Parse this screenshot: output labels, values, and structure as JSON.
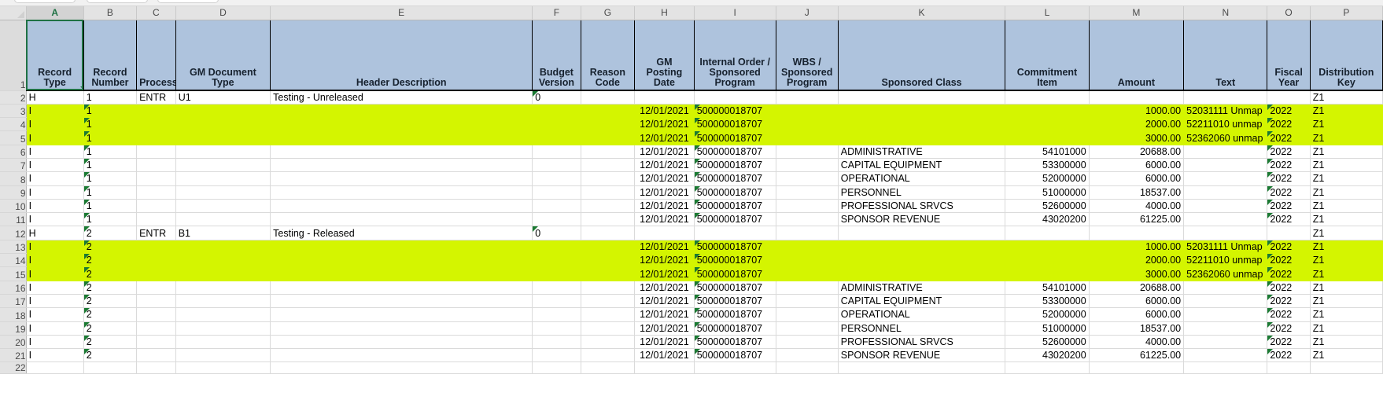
{
  "app": {
    "type": "spreadsheet",
    "selected_cell": "A1",
    "highlight_color": "#d4f500",
    "header_fill_color": "#aec3dd",
    "selection_color": "#1f7244"
  },
  "columns": {
    "letters": [
      "A",
      "B",
      "C",
      "D",
      "E",
      "F",
      "G",
      "H",
      "I",
      "J",
      "K",
      "L",
      "M",
      "N",
      "O",
      "P"
    ],
    "widths": [
      62,
      57,
      42,
      102,
      282,
      52,
      58,
      64,
      88,
      67,
      180,
      90,
      102,
      90,
      46,
      78
    ],
    "headers": [
      "Record Type",
      "Record Number",
      "Process",
      "GM Document Type",
      "Header Description",
      "Budget Version",
      "Reason Code",
      "GM Posting Date",
      "Internal Order / Sponsored Program",
      "WBS / Sponsored Program",
      "Sponsored Class",
      "Commitment Item",
      "Amount",
      "Text",
      "Fiscal Year",
      "Distribution Key"
    ]
  },
  "row_numbers": [
    "1",
    "2",
    "3",
    "4",
    "5",
    "6",
    "7",
    "8",
    "9",
    "10",
    "11",
    "12",
    "13",
    "14",
    "15",
    "16",
    "17",
    "18",
    "19",
    "20",
    "21",
    "22"
  ],
  "rows": [
    {
      "n": "2",
      "highlight": false,
      "cells": [
        "H",
        "1",
        "ENTR",
        "U1",
        "Testing  - Unreleased",
        "0",
        "",
        "",
        "",
        "",
        "",
        "",
        "",
        "",
        "",
        "Z1"
      ],
      "flags": [
        false,
        false,
        false,
        false,
        false,
        true,
        false,
        false,
        false,
        false,
        false,
        false,
        false,
        false,
        false,
        false
      ]
    },
    {
      "n": "3",
      "highlight": true,
      "cells": [
        "I",
        "1",
        "",
        "",
        "",
        "",
        "",
        "12/01/2021",
        "500000018707",
        "",
        "",
        "",
        "1000.00",
        "52031111 Unmap",
        "2022",
        "Z1"
      ],
      "flags": [
        false,
        true,
        false,
        false,
        false,
        false,
        false,
        false,
        true,
        false,
        false,
        false,
        false,
        false,
        true,
        false
      ]
    },
    {
      "n": "4",
      "highlight": true,
      "cells": [
        "I",
        "1",
        "",
        "",
        "",
        "",
        "",
        "12/01/2021",
        "500000018707",
        "",
        "",
        "",
        "2000.00",
        "52211010 unmap",
        "2022",
        "Z1"
      ],
      "flags": [
        false,
        true,
        false,
        false,
        false,
        false,
        false,
        false,
        true,
        false,
        false,
        false,
        false,
        false,
        true,
        false
      ]
    },
    {
      "n": "5",
      "highlight": true,
      "cells": [
        "I",
        "1",
        "",
        "",
        "",
        "",
        "",
        "12/01/2021",
        "500000018707",
        "",
        "",
        "",
        "3000.00",
        "52362060 unmap",
        "2022",
        "Z1"
      ],
      "flags": [
        false,
        true,
        false,
        false,
        false,
        false,
        false,
        false,
        true,
        false,
        false,
        false,
        false,
        false,
        true,
        false
      ]
    },
    {
      "n": "6",
      "highlight": false,
      "cells": [
        "I",
        "1",
        "",
        "",
        "",
        "",
        "",
        "12/01/2021",
        "500000018707",
        "",
        "ADMINISTRATIVE",
        "54101000",
        "20688.00",
        "",
        "2022",
        "Z1"
      ],
      "flags": [
        false,
        true,
        false,
        false,
        false,
        false,
        false,
        false,
        true,
        false,
        false,
        false,
        false,
        false,
        true,
        false
      ]
    },
    {
      "n": "7",
      "highlight": false,
      "cells": [
        "I",
        "1",
        "",
        "",
        "",
        "",
        "",
        "12/01/2021",
        "500000018707",
        "",
        "CAPITAL EQUIPMENT",
        "53300000",
        "6000.00",
        "",
        "2022",
        "Z1"
      ],
      "flags": [
        false,
        true,
        false,
        false,
        false,
        false,
        false,
        false,
        true,
        false,
        false,
        false,
        false,
        false,
        true,
        false
      ]
    },
    {
      "n": "8",
      "highlight": false,
      "cells": [
        "I",
        "1",
        "",
        "",
        "",
        "",
        "",
        "12/01/2021",
        "500000018707",
        "",
        "OPERATIONAL",
        "52000000",
        "6000.00",
        "",
        "2022",
        "Z1"
      ],
      "flags": [
        false,
        true,
        false,
        false,
        false,
        false,
        false,
        false,
        true,
        false,
        false,
        false,
        false,
        false,
        true,
        false
      ]
    },
    {
      "n": "9",
      "highlight": false,
      "cells": [
        "I",
        "1",
        "",
        "",
        "",
        "",
        "",
        "12/01/2021",
        "500000018707",
        "",
        "PERSONNEL",
        "51000000",
        "18537.00",
        "",
        "2022",
        "Z1"
      ],
      "flags": [
        false,
        true,
        false,
        false,
        false,
        false,
        false,
        false,
        true,
        false,
        false,
        false,
        false,
        false,
        true,
        false
      ]
    },
    {
      "n": "10",
      "highlight": false,
      "cells": [
        "I",
        "1",
        "",
        "",
        "",
        "",
        "",
        "12/01/2021",
        "500000018707",
        "",
        "PROFESSIONAL SRVCS",
        "52600000",
        "4000.00",
        "",
        "2022",
        "Z1"
      ],
      "flags": [
        false,
        true,
        false,
        false,
        false,
        false,
        false,
        false,
        true,
        false,
        false,
        false,
        false,
        false,
        true,
        false
      ]
    },
    {
      "n": "11",
      "highlight": false,
      "cells": [
        "I",
        "1",
        "",
        "",
        "",
        "",
        "",
        "12/01/2021",
        "500000018707",
        "",
        "SPONSOR REVENUE",
        "43020200",
        "61225.00",
        "",
        "2022",
        "Z1"
      ],
      "flags": [
        false,
        true,
        false,
        false,
        false,
        false,
        false,
        false,
        true,
        false,
        false,
        false,
        false,
        false,
        true,
        false
      ]
    },
    {
      "n": "12",
      "highlight": false,
      "cells": [
        "H",
        "2",
        "ENTR",
        "B1",
        "Testing  - Released",
        "0",
        "",
        "",
        "",
        "",
        "",
        "",
        "",
        "",
        "",
        "Z1"
      ],
      "flags": [
        false,
        true,
        false,
        false,
        false,
        true,
        false,
        false,
        false,
        false,
        false,
        false,
        false,
        false,
        false,
        false
      ]
    },
    {
      "n": "13",
      "highlight": true,
      "cells": [
        "I",
        "2",
        "",
        "",
        "",
        "",
        "",
        "12/01/2021",
        "500000018707",
        "",
        "",
        "",
        "1000.00",
        "52031111 Unmap",
        "2022",
        "Z1"
      ],
      "flags": [
        false,
        true,
        false,
        false,
        false,
        false,
        false,
        false,
        true,
        false,
        false,
        false,
        false,
        false,
        true,
        false
      ]
    },
    {
      "n": "14",
      "highlight": true,
      "cells": [
        "I",
        "2",
        "",
        "",
        "",
        "",
        "",
        "12/01/2021",
        "500000018707",
        "",
        "",
        "",
        "2000.00",
        "52211010 unmap",
        "2022",
        "Z1"
      ],
      "flags": [
        false,
        true,
        false,
        false,
        false,
        false,
        false,
        false,
        true,
        false,
        false,
        false,
        false,
        false,
        true,
        false
      ]
    },
    {
      "n": "15",
      "highlight": true,
      "cells": [
        "I",
        "2",
        "",
        "",
        "",
        "",
        "",
        "12/01/2021",
        "500000018707",
        "",
        "",
        "",
        "3000.00",
        "52362060 unmap",
        "2022",
        "Z1"
      ],
      "flags": [
        false,
        true,
        false,
        false,
        false,
        false,
        false,
        false,
        true,
        false,
        false,
        false,
        false,
        false,
        true,
        false
      ]
    },
    {
      "n": "16",
      "highlight": false,
      "cells": [
        "I",
        "2",
        "",
        "",
        "",
        "",
        "",
        "12/01/2021",
        "500000018707",
        "",
        "ADMINISTRATIVE",
        "54101000",
        "20688.00",
        "",
        "2022",
        "Z1"
      ],
      "flags": [
        false,
        true,
        false,
        false,
        false,
        false,
        false,
        false,
        true,
        false,
        false,
        false,
        false,
        false,
        true,
        false
      ]
    },
    {
      "n": "17",
      "highlight": false,
      "cells": [
        "I",
        "2",
        "",
        "",
        "",
        "",
        "",
        "12/01/2021",
        "500000018707",
        "",
        "CAPITAL EQUIPMENT",
        "53300000",
        "6000.00",
        "",
        "2022",
        "Z1"
      ],
      "flags": [
        false,
        true,
        false,
        false,
        false,
        false,
        false,
        false,
        true,
        false,
        false,
        false,
        false,
        false,
        true,
        false
      ]
    },
    {
      "n": "18",
      "highlight": false,
      "cells": [
        "I",
        "2",
        "",
        "",
        "",
        "",
        "",
        "12/01/2021",
        "500000018707",
        "",
        "OPERATIONAL",
        "52000000",
        "6000.00",
        "",
        "2022",
        "Z1"
      ],
      "flags": [
        false,
        true,
        false,
        false,
        false,
        false,
        false,
        false,
        true,
        false,
        false,
        false,
        false,
        false,
        true,
        false
      ]
    },
    {
      "n": "19",
      "highlight": false,
      "cells": [
        "I",
        "2",
        "",
        "",
        "",
        "",
        "",
        "12/01/2021",
        "500000018707",
        "",
        "PERSONNEL",
        "51000000",
        "18537.00",
        "",
        "2022",
        "Z1"
      ],
      "flags": [
        false,
        true,
        false,
        false,
        false,
        false,
        false,
        false,
        true,
        false,
        false,
        false,
        false,
        false,
        true,
        false
      ]
    },
    {
      "n": "20",
      "highlight": false,
      "cells": [
        "I",
        "2",
        "",
        "",
        "",
        "",
        "",
        "12/01/2021",
        "500000018707",
        "",
        "PROFESSIONAL SRVCS",
        "52600000",
        "4000.00",
        "",
        "2022",
        "Z1"
      ],
      "flags": [
        false,
        true,
        false,
        false,
        false,
        false,
        false,
        false,
        true,
        false,
        false,
        false,
        false,
        false,
        true,
        false
      ]
    },
    {
      "n": "21",
      "highlight": false,
      "cells": [
        "I",
        "2",
        "",
        "",
        "",
        "",
        "",
        "12/01/2021",
        "500000018707",
        "",
        "SPONSOR REVENUE",
        "43020200",
        "61225.00",
        "",
        "2022",
        "Z1"
      ],
      "flags": [
        false,
        true,
        false,
        false,
        false,
        false,
        false,
        false,
        true,
        false,
        false,
        false,
        false,
        false,
        true,
        false
      ]
    }
  ],
  "alignments": [
    "l",
    "l",
    "l",
    "l",
    "l",
    "l",
    "l",
    "c",
    "l",
    "l",
    "l",
    "r",
    "r",
    "l",
    "l",
    "l"
  ]
}
